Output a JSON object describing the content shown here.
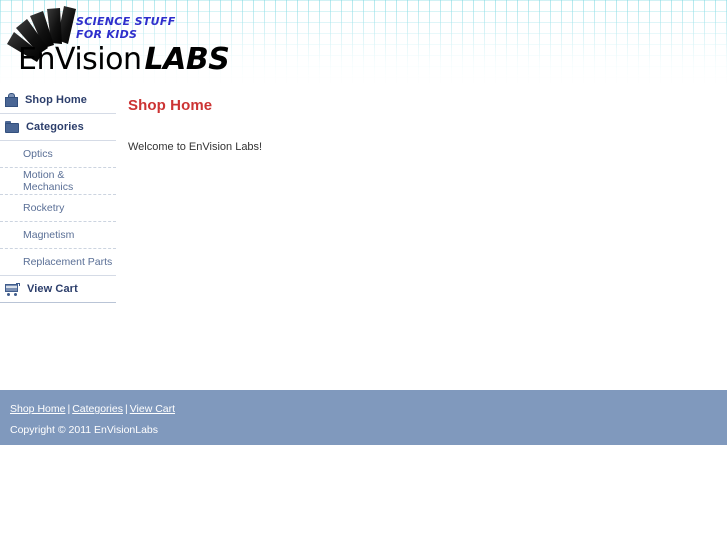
{
  "header": {
    "logo": {
      "tagline": "SCIENCE STUFF\nFOR KIDS",
      "wordmark_primary": "EnVision",
      "wordmark_secondary": "LABS",
      "blades_icon": "fan-blades-icon"
    }
  },
  "sidebar": {
    "items": [
      {
        "label": "Shop Home",
        "icon": "shopping-bag-icon",
        "level": "top"
      },
      {
        "label": "Categories",
        "icon": "folder-icon",
        "level": "top"
      },
      {
        "label": "Optics",
        "level": "sub"
      },
      {
        "label": "Motion & Mechanics",
        "level": "sub"
      },
      {
        "label": "Rocketry",
        "level": "sub"
      },
      {
        "label": "Magnetism",
        "level": "sub"
      },
      {
        "label": "Replacement Parts",
        "level": "sub"
      },
      {
        "label": "View Cart",
        "icon": "shopping-cart-icon",
        "level": "top"
      }
    ]
  },
  "main": {
    "title": "Shop Home",
    "welcome": "Welcome to EnVision Labs!"
  },
  "footer": {
    "links": [
      {
        "label": "Shop Home"
      },
      {
        "label": "Categories"
      },
      {
        "label": "View Cart"
      }
    ],
    "separator": "|",
    "copyright": "Copyright © 2011 EnVisionLabs"
  },
  "colors": {
    "accent_red": "#cc3333",
    "nav_navy": "#2c3e6b",
    "nav_sub_blue": "#5a6f96",
    "footer_blue": "#8099bd",
    "grid_cyan": "#78d7e1",
    "tagline_blue": "#2f2fcc"
  }
}
